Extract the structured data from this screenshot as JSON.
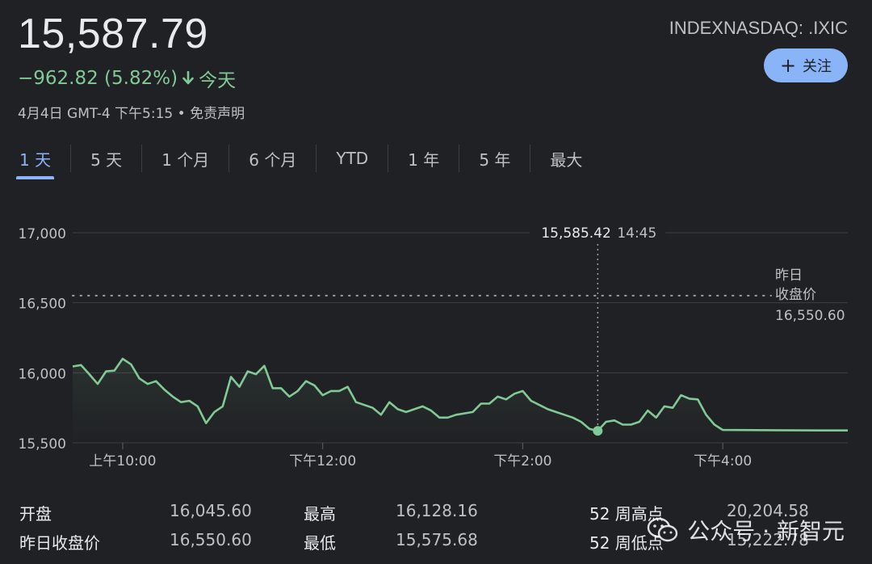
{
  "header": {
    "price": "15,587.79",
    "change": "−962.82 (5.82%)",
    "change_period": "今天",
    "timestamp": "4月4日 GMT-4 下午5:15",
    "disclaimer": "免责声明",
    "ticker": "INDEXNASDAQ: .IXIC",
    "follow_label": "关注",
    "change_color": "#81c995",
    "accent_color": "#8ab4f8"
  },
  "tabs": [
    {
      "label": "1 天",
      "active": true
    },
    {
      "label": "5 天",
      "active": false
    },
    {
      "label": "1 个月",
      "active": false
    },
    {
      "label": "6 个月",
      "active": false
    },
    {
      "label": "YTD",
      "active": false
    },
    {
      "label": "1 年",
      "active": false
    },
    {
      "label": "5 年",
      "active": false
    },
    {
      "label": "最大",
      "active": false
    }
  ],
  "chart_data": {
    "type": "line",
    "x_tick_labels": [
      "上午10:00",
      "下午12:00",
      "下午2:00",
      "下午4:00"
    ],
    "x_ticks": [
      "10:00",
      "12:00",
      "14:00",
      "16:00"
    ],
    "y_ticks": [
      15500,
      16000,
      16500,
      17000
    ],
    "y_tick_labels": [
      "15,500",
      "16,000",
      "16,500",
      "17,000"
    ],
    "ylim": [
      15500,
      17000
    ],
    "xlim": [
      "09:30",
      "17:15"
    ],
    "grid": true,
    "series": [
      {
        "x": [
          "09:30",
          "09:35",
          "09:40",
          "09:45",
          "09:50",
          "09:55",
          "10:00",
          "10:05",
          "10:10",
          "10:15",
          "10:20",
          "10:25",
          "10:30",
          "10:35",
          "10:40",
          "10:45",
          "10:50",
          "10:55",
          "11:00",
          "11:05",
          "11:10",
          "11:15",
          "11:20",
          "11:25",
          "11:30",
          "11:35",
          "11:40",
          "11:45",
          "11:50",
          "11:55",
          "12:00",
          "12:05",
          "12:10",
          "12:15",
          "12:20",
          "12:25",
          "12:30",
          "12:35",
          "12:40",
          "12:45",
          "12:50",
          "12:55",
          "13:00",
          "13:05",
          "13:10",
          "13:15",
          "13:20",
          "13:25",
          "13:30",
          "13:35",
          "13:40",
          "13:45",
          "13:50",
          "13:55",
          "14:00",
          "14:05",
          "14:10",
          "14:15",
          "14:20",
          "14:25",
          "14:30",
          "14:35",
          "14:40",
          "14:45",
          "14:50",
          "14:55",
          "15:00",
          "15:05",
          "15:10",
          "15:15",
          "15:20",
          "15:25",
          "15:30",
          "15:35",
          "15:40",
          "15:45",
          "15:50",
          "15:55",
          "16:00",
          "16:30",
          "17:00",
          "17:15"
        ],
        "values": [
          16045,
          16055,
          15990,
          15920,
          16010,
          16015,
          16100,
          16060,
          15960,
          15920,
          15940,
          15880,
          15830,
          15790,
          15800,
          15760,
          15640,
          15720,
          15760,
          15970,
          15900,
          16010,
          15990,
          16050,
          15890,
          15890,
          15830,
          15870,
          15940,
          15910,
          15840,
          15870,
          15870,
          15900,
          15790,
          15770,
          15750,
          15700,
          15790,
          15740,
          15720,
          15740,
          15760,
          15730,
          15680,
          15680,
          15700,
          15710,
          15720,
          15780,
          15780,
          15830,
          15810,
          15850,
          15870,
          15800,
          15770,
          15740,
          15720,
          15700,
          15680,
          15650,
          15600,
          15585,
          15650,
          15660,
          15630,
          15630,
          15650,
          15730,
          15680,
          15760,
          15750,
          15840,
          15815,
          15810,
          15700,
          15630,
          15592,
          15590,
          15588,
          15588
        ]
      }
    ],
    "previous_close_label": [
      "昨日",
      "收盘价"
    ],
    "previous_close_value": 16550.6,
    "previous_close_text": "16,550.60",
    "tooltip": {
      "time": "14:45",
      "value_text": "15,585.42",
      "value": 15585.42
    },
    "line_color": "#81c995"
  },
  "stats": {
    "open_label": "开盘",
    "open_value": "16,045.60",
    "prev_close_label": "昨日收盘价",
    "prev_close_value": "16,550.60",
    "high_label": "最高",
    "high_value": "16,128.16",
    "low_label": "最低",
    "low_value": "15,575.68",
    "week52_high_label": "52 周高点",
    "week52_high_value": "20,204.58",
    "week52_low_label": "52 周低点",
    "week52_low_value": "15,222.78"
  },
  "watermark": {
    "text": "公众号 · 新智元",
    "icon": "wechat-icon"
  }
}
